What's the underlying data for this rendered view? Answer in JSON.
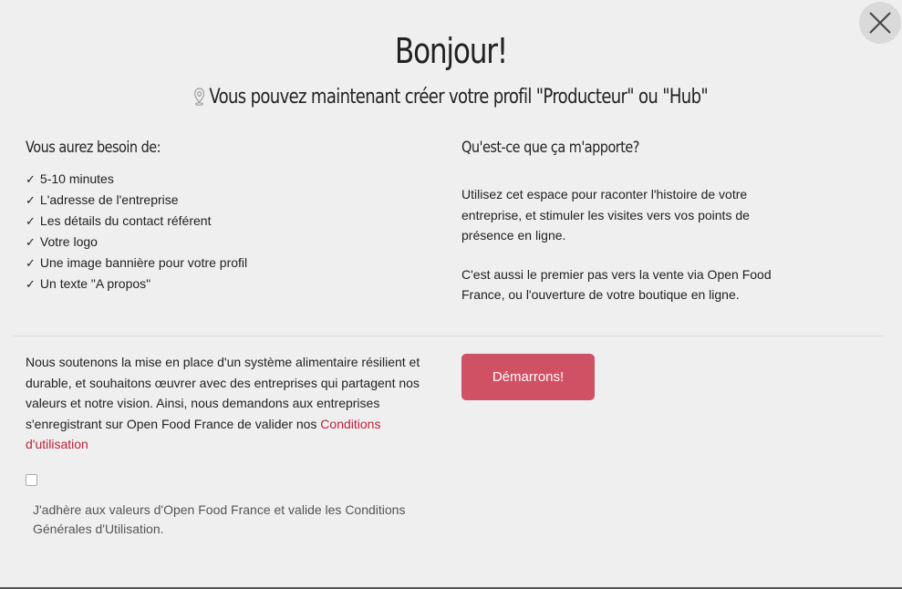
{
  "modal": {
    "title": "Bonjour!",
    "subtitle": "Vous pouvez maintenant créer votre profil \"Producteur\" ou \"Hub\""
  },
  "needs": {
    "heading": "Vous aurez besoin de:",
    "check_glyph": "✓",
    "items": [
      "5-10 minutes",
      "L'adresse de l'entreprise",
      "Les détails du contact référent",
      "Votre logo",
      "Une image bannière pour votre profil",
      "Un texte \"A propos\""
    ]
  },
  "benefits": {
    "heading": "Qu'est-ce que ça m'apporte?",
    "paragraph1": "Utilisez cet espace pour raconter l'histoire de votre entreprise, et stimuler les visites vers vos points de présence en ligne.",
    "paragraph2": "C'est aussi le premier pas vers la vente via Open Food France, ou l'ouverture de votre boutique en ligne."
  },
  "terms": {
    "text": "Nous soutenons la mise en place d'un système alimentaire résilient et durable, et souhaitons œuvrer avec des entreprises qui partagent nos valeurs et notre vision. Ainsi, nous demandons aux entreprises s'enregistrant sur Open Food France de valider nos ",
    "link_label": "Conditions d'utilisation",
    "checkbox_label": "J'adhère aux valeurs d'Open Food France et valide les Conditions Générales d'Utilisation.",
    "checked": false
  },
  "actions": {
    "start_label": "Démarrons!",
    "close_icon": "close-icon"
  },
  "colors": {
    "accent": "#d05164",
    "link": "#c0213c",
    "background": "#efefef"
  }
}
